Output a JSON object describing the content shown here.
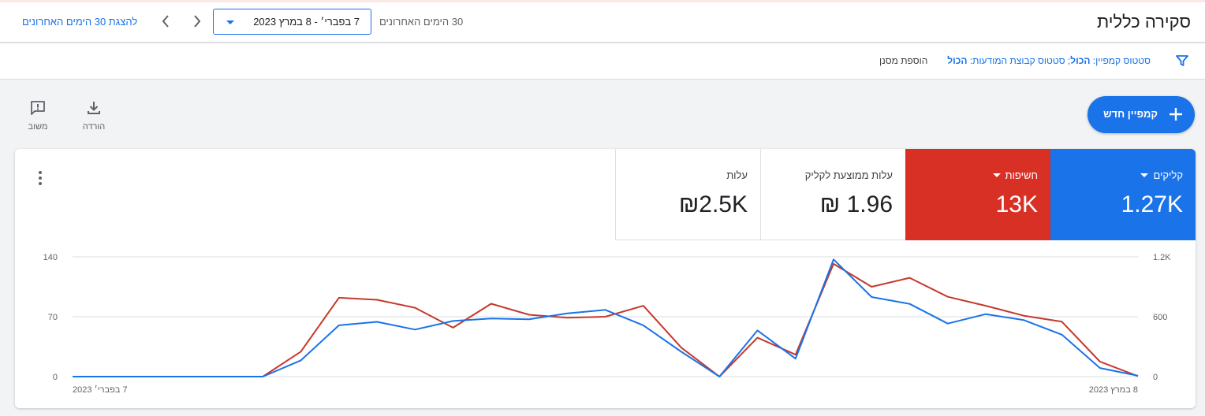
{
  "header": {
    "title": "סקירה כללית",
    "show_last": "להצגת 30 הימים האחרונים",
    "date_range": "7 בפברי׳ - 8 במרץ 2023",
    "range_label": "30 הימים האחרונים"
  },
  "filters": {
    "prefix_campaign": "סטטוס קמפיין: ",
    "campaign_value": "הכול",
    "prefix_adgroup": "; סטטוס קבוצת המודעות: ",
    "adgroup_value": "הכול",
    "add_filter": "הוספת מסנן"
  },
  "toolbar": {
    "new_campaign": "קמפיין חדש",
    "download": "הורדה",
    "feedback": "משוב"
  },
  "metrics": {
    "clicks": {
      "label": "קליקים",
      "value": "1.27K"
    },
    "impressions": {
      "label": "חשיפות",
      "value": "13K"
    },
    "avg_cpc": {
      "label": "עלות ממוצעת לקליק",
      "value": "1.96 ₪"
    },
    "cost": {
      "label": "עלות",
      "value": "₪2.5K"
    }
  },
  "colors": {
    "accent": "#1a73e8",
    "impressions": "#d93025",
    "clicks_line": "#1a73e8",
    "impressions_line": "#c5392b"
  },
  "chart_data": {
    "type": "line",
    "x_start_label": "7 בפברי׳ 2023",
    "x_end_label": "8 במרץ 2023",
    "left_axis": {
      "ticks": [
        "0",
        "70",
        "140"
      ],
      "range": [
        0,
        140
      ]
    },
    "right_axis": {
      "ticks": [
        "0",
        "600",
        "1.2K"
      ],
      "range": [
        0,
        1200
      ]
    },
    "grid": true,
    "series": [
      {
        "axis": "left",
        "color": "#1a73e8",
        "values": [
          0,
          0,
          0,
          0,
          0,
          0,
          19,
          60,
          64,
          55,
          65,
          68,
          67,
          74,
          78,
          60,
          29,
          0,
          54,
          21,
          137,
          93,
          85,
          62,
          73,
          66,
          49,
          10,
          1
        ]
      },
      {
        "axis": "right",
        "color": "#c5392b",
        "values": [
          0,
          0,
          0,
          0,
          0,
          0,
          250,
          790,
          770,
          690,
          490,
          730,
          620,
          590,
          600,
          710,
          290,
          0,
          390,
          220,
          1130,
          900,
          990,
          800,
          710,
          610,
          550,
          150,
          5
        ]
      }
    ]
  }
}
